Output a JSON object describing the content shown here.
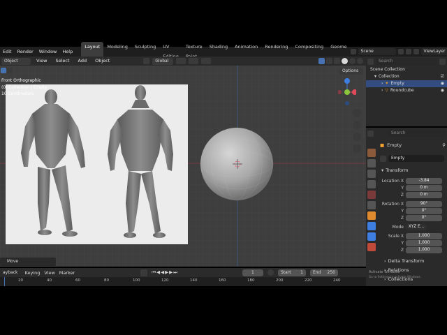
{
  "menu": [
    "Edit",
    "Render",
    "Window",
    "Help"
  ],
  "workspaces": [
    "Layout",
    "Modeling",
    "Sculpting",
    "UV Editing",
    "Texture Paint",
    "Shading",
    "Animation",
    "Rendering",
    "Compositing",
    "Geome"
  ],
  "active_workspace": "Layout",
  "scene": "Scene",
  "view_layer": "ViewLayer",
  "header": {
    "mode": "Object Mode",
    "view": "View",
    "select": "Select",
    "add": "Add",
    "object": "Object",
    "orientation": "Global",
    "options": "Options"
  },
  "viewport": {
    "view_name": "Front Orthographic",
    "collection_info": "(0) Collection | Empty",
    "scale_info": "10 Centimeters"
  },
  "operator_panel": "Move",
  "outliner": {
    "search_placeholder": "Search",
    "scene_collection": "Scene Collection",
    "collection": "Collection",
    "items": [
      "Empty",
      "Roundcube"
    ]
  },
  "properties": {
    "search_placeholder": "Search",
    "object_name": "Empty",
    "datablock": "Empty",
    "transform_title": "Transform",
    "location_label": "Location X",
    "location": [
      "-3.84",
      "0 m",
      "0 m"
    ],
    "rotation_label": "Rotation X",
    "rotation": [
      "90°",
      "0°",
      "0°"
    ],
    "mode_label": "Mode",
    "mode_value": "XYZ E...",
    "scale_label": "Scale X",
    "scale": [
      "1.000",
      "1.000",
      "1.000"
    ],
    "axis_y": "Y",
    "axis_z": "Z",
    "delta": "Delta Transform",
    "relations": "Relations",
    "collections": "Collections",
    "watermark1": "Activate Windows",
    "watermark2": "Go to Settings to activate Windows."
  },
  "timeline": {
    "playback": "ayback",
    "keying": "Keying",
    "view": "View",
    "marker": "Marker",
    "current_frame": "1",
    "start_label": "Start",
    "start": "1",
    "end_label": "End",
    "end": "250",
    "ticks": [
      "20",
      "40",
      "60",
      "80",
      "100",
      "120",
      "140",
      "160",
      "180",
      "200",
      "220",
      "240"
    ]
  },
  "colors": {
    "accent": "#4772b3",
    "selection": "#334d80",
    "viewport_bg": "#3e3e3e",
    "panel_bg": "#2a2a2a",
    "gizmo_x": "#e04a5a",
    "gizmo_y": "#8bc43a",
    "gizmo_z": "#3d7ee0",
    "empty_orange": "#f0a030"
  }
}
